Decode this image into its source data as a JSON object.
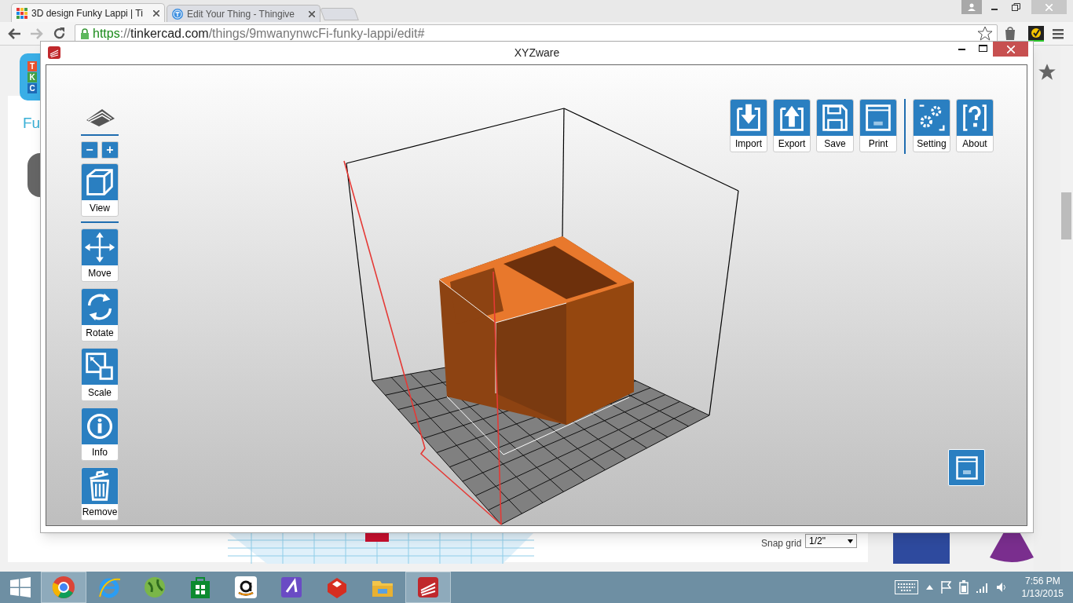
{
  "browser": {
    "tabs": [
      {
        "title": "3D design Funky Lappi | Ti",
        "selected": true
      },
      {
        "title": "Edit Your Thing - Thingive",
        "selected": false
      }
    ],
    "url": {
      "scheme": "https",
      "separator": "://",
      "host": "tinkercad.com",
      "path": "/things/9mwanynwcFi-funky-lappi/edit#"
    }
  },
  "background_page": {
    "logo_letters": [
      "T",
      "K",
      "C"
    ],
    "title_fragment": "Fu",
    "snap_grid": {
      "label": "Snap grid",
      "value": "1/2\""
    }
  },
  "window": {
    "title": "XYZware"
  },
  "zoom_buttons": [
    "−",
    "+"
  ],
  "left_tools": [
    {
      "kind": "view",
      "label": "View"
    },
    {
      "kind": "move",
      "label": "Move"
    },
    {
      "kind": "rotate",
      "label": "Rotate"
    },
    {
      "kind": "scale",
      "label": "Scale"
    },
    {
      "kind": "info",
      "label": "Info"
    },
    {
      "kind": "remove",
      "label": "Remove"
    }
  ],
  "top_tools": [
    {
      "kind": "import",
      "label": "Import",
      "separator_before": false
    },
    {
      "kind": "export",
      "label": "Export",
      "separator_before": false
    },
    {
      "kind": "save",
      "label": "Save",
      "separator_before": false
    },
    {
      "kind": "print",
      "label": "Print",
      "separator_before": false
    },
    {
      "kind": "setting",
      "label": "Setting",
      "separator_before": true
    },
    {
      "kind": "about",
      "label": "About",
      "separator_before": false
    }
  ],
  "taskbar": {
    "apps": [
      {
        "kind": "browser",
        "selected": true
      },
      {
        "kind": "ie",
        "selected": false
      },
      {
        "kind": "globe",
        "selected": false
      },
      {
        "kind": "store",
        "selected": false
      },
      {
        "kind": "amazon",
        "selected": false
      },
      {
        "kind": "purple",
        "selected": false
      },
      {
        "kind": "sketch",
        "selected": false
      },
      {
        "kind": "folder",
        "selected": false
      },
      {
        "kind": "xyz",
        "selected": true
      }
    ],
    "time": "7:56 PM",
    "date": "1/13/2015"
  }
}
